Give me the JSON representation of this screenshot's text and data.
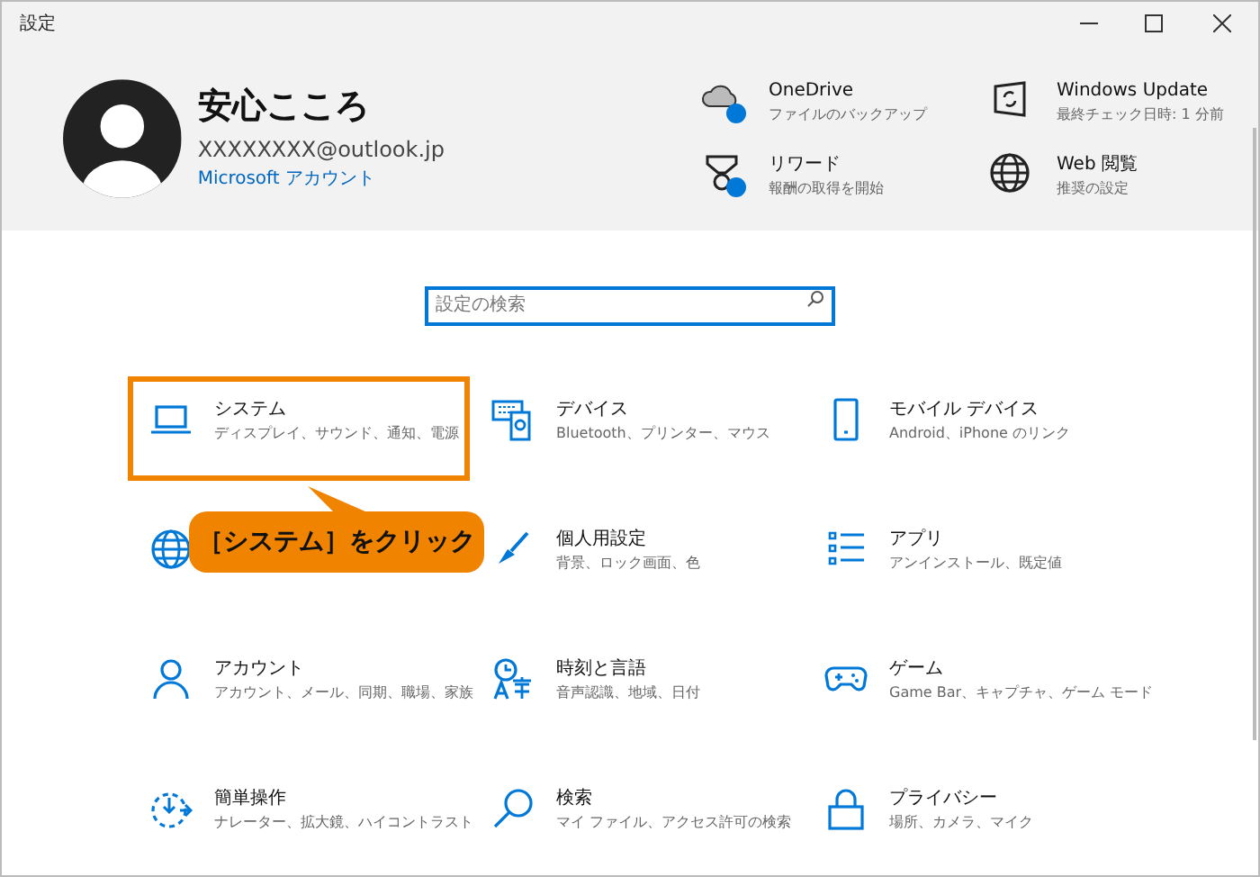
{
  "window": {
    "title": "設定"
  },
  "user": {
    "name": "安心こころ",
    "email": "XXXXXXXX@outlook.jp",
    "account_link": "Microsoft アカウント"
  },
  "quick_links": [
    {
      "title": "OneDrive",
      "subtitle": "ファイルのバックアップ",
      "badge": true
    },
    {
      "title": "Windows Update",
      "subtitle": "最終チェック日時: 1 分前",
      "badge": false
    },
    {
      "title": "リワード",
      "subtitle": "報酬の取得を開始",
      "badge": true
    },
    {
      "title": "Web 閲覧",
      "subtitle": "推奨の設定",
      "badge": false
    }
  ],
  "search": {
    "placeholder": "設定の検索"
  },
  "categories": [
    {
      "title": "システム",
      "subtitle": "ディスプレイ、サウンド、通知、電源",
      "highlighted": true
    },
    {
      "title": "デバイス",
      "subtitle": "Bluetooth、プリンター、マウス",
      "highlighted": false
    },
    {
      "title": "モバイル デバイス",
      "subtitle": "Android、iPhone のリンク",
      "highlighted": false
    },
    {
      "highlighted": false
    },
    {
      "title": "個人用設定",
      "subtitle": "背景、ロック画面、色",
      "highlighted": false
    },
    {
      "title": "アプリ",
      "subtitle": "アンインストール、既定値",
      "highlighted": false
    },
    {
      "title": "アカウント",
      "subtitle": "アカウント、メール、同期、職場、家族",
      "highlighted": false
    },
    {
      "title": "時刻と言語",
      "subtitle": "音声認識、地域、日付",
      "highlighted": false
    },
    {
      "title": "ゲーム",
      "subtitle": "Game Bar、キャプチャ、ゲーム モード",
      "highlighted": false
    },
    {
      "title": "簡単操作",
      "subtitle": "ナレーター、拡大鏡、ハイコントラスト",
      "highlighted": false
    },
    {
      "title": "検索",
      "subtitle": "マイ ファイル、アクセス許可の検索",
      "highlighted": false
    },
    {
      "title": "プライバシー",
      "subtitle": "場所、カメラ、マイク",
      "highlighted": false
    }
  ],
  "callout": {
    "text": "［システム］をクリック"
  }
}
